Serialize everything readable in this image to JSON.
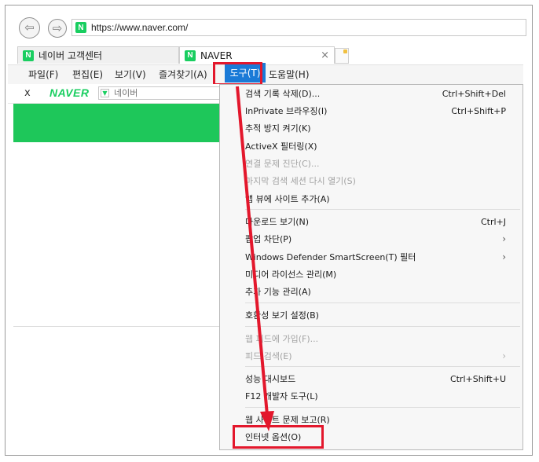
{
  "browser": {
    "url": "https://www.naver.com/",
    "favicon_letter": "N",
    "tabs": [
      {
        "label": "네이버 고객센터"
      },
      {
        "label": "NAVER"
      }
    ],
    "tab_close": "×"
  },
  "menubar": {
    "items": [
      "파일(F)",
      "편집(E)",
      "보기(V)",
      "즐겨찾기(A)",
      "도구(T)",
      "도움말(H)"
    ]
  },
  "naver_toolbar": {
    "close": "x",
    "logo": "NAVER",
    "search_placeholder": "네이버"
  },
  "tools_menu": {
    "items": [
      {
        "label": "검색 기록 삭제(D)...",
        "shortcut": "Ctrl+Shift+Del"
      },
      {
        "label": "InPrivate 브라우징(I)",
        "shortcut": "Ctrl+Shift+P"
      },
      {
        "label": "추적 방지 켜기(K)"
      },
      {
        "label": "ActiveX 필터링(X)"
      },
      {
        "label": "연결 문제 진단(C)..."
      },
      {
        "label": "마지막 검색 세션 다시 열기(S)"
      },
      {
        "label": "앱 뷰에 사이트 추가(A)"
      },
      {
        "label": "다운로드 보기(N)",
        "shortcut": "Ctrl+J"
      },
      {
        "label": "팝업 차단(P)",
        "arrow": "›"
      },
      {
        "label": "Windows Defender SmartScreen(T) 필터",
        "arrow": "›"
      },
      {
        "label": "미디어 라이선스 관리(M)"
      },
      {
        "label": "추가 기능 관리(A)"
      },
      {
        "label": "호환성 보기 설정(B)"
      },
      {
        "label": "웹 피드에 가입(F)..."
      },
      {
        "label": "피드 검색(E)",
        "arrow": "›"
      },
      {
        "label": "성능 대시보드",
        "shortcut": "Ctrl+Shift+U"
      },
      {
        "label": "F12 개발자 도구(L)"
      },
      {
        "label": "웹 사이트 문제 보고(R)"
      },
      {
        "label": "인터넷 옵션(O)"
      }
    ]
  },
  "colors": {
    "menu_highlight": "#1a7ad7",
    "annotation_red": "#e3172c",
    "naver_green": "#1ec75a"
  }
}
